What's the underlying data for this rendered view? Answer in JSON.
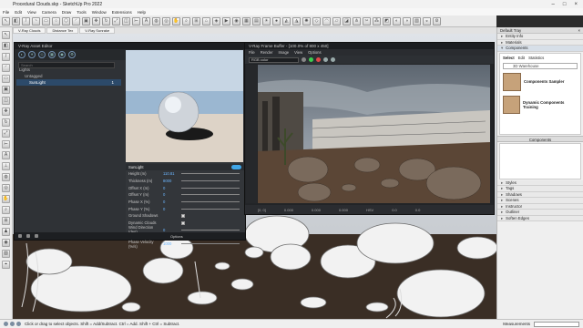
{
  "window": {
    "title": "Procedural Clouds.skp - SketchUp Pro 2022"
  },
  "menubar": {
    "items": [
      "File",
      "Edit",
      "View",
      "Camera",
      "Draw",
      "Tools",
      "Window",
      "Extensions",
      "Help"
    ]
  },
  "scene_tabs": [
    "V-Ray Clouds",
    "Distance Tex",
    "V-Ray Sunrake"
  ],
  "asset_editor": {
    "title": "V-Ray Asset Editor",
    "search_placeholder": "Search",
    "tree": [
      {
        "label": "Lights"
      },
      {
        "label": "Untagged"
      },
      {
        "label": "SunLight",
        "count": "1"
      }
    ],
    "section": "SunLight",
    "params": [
      {
        "label": "Height (m)",
        "value": "110.81"
      },
      {
        "label": "Thickness (m)",
        "value": "8000"
      },
      {
        "label": "Offset X (m)",
        "value": "0"
      },
      {
        "label": "Offset Y (m)",
        "value": "0"
      },
      {
        "label": "Phase X (%)",
        "value": "0"
      },
      {
        "label": "Phase Y (%)",
        "value": "0"
      },
      {
        "label": "Ground Shadows",
        "value": ""
      },
      {
        "label": "Dynamic Clouds",
        "value": ""
      },
      {
        "label": "Wind Direction (deg)",
        "value": "0"
      },
      {
        "label": "Wind Speed (m/s)",
        "value": "1"
      },
      {
        "label": "Phase Velocity (%/s)",
        "value": "1000"
      }
    ],
    "options_label": "Options"
  },
  "frame_buffer": {
    "title": "V-Ray Frame Buffer - [100.0% of 800 x 450]",
    "menu": [
      "File",
      "Render",
      "Image",
      "View",
      "Options"
    ],
    "channel": "RGB color",
    "footer": [
      "[0, 0]",
      "0.000",
      "0.000",
      "0.000",
      "HSV",
      "0.0",
      "0.0"
    ]
  },
  "tray": {
    "title": "Default Tray",
    "sections_top": [
      "Entity Info",
      "Materials",
      "Components"
    ],
    "tabs": [
      "Select",
      "Edit",
      "Statistics"
    ],
    "search_value": "3D Warehouse",
    "components": [
      {
        "name": "Components Sampler"
      },
      {
        "name": "Dynamic Components Training"
      }
    ],
    "components_label": "Components",
    "sections_bottom": [
      "Styles",
      "Tags",
      "Shadows",
      "Scenes",
      "Instructor",
      "Outliner",
      "Soften Edges"
    ]
  },
  "status": {
    "message": "Click or drag to select objects. Shift = Add/Subtract. Ctrl = Add. Shift + Ctrl = Subtract.",
    "measurements_label": "Measurements"
  },
  "colors": {
    "accent": "#3fa5e6",
    "vfb_green": "#3ccf4e",
    "vfb_red": "#e04848"
  }
}
